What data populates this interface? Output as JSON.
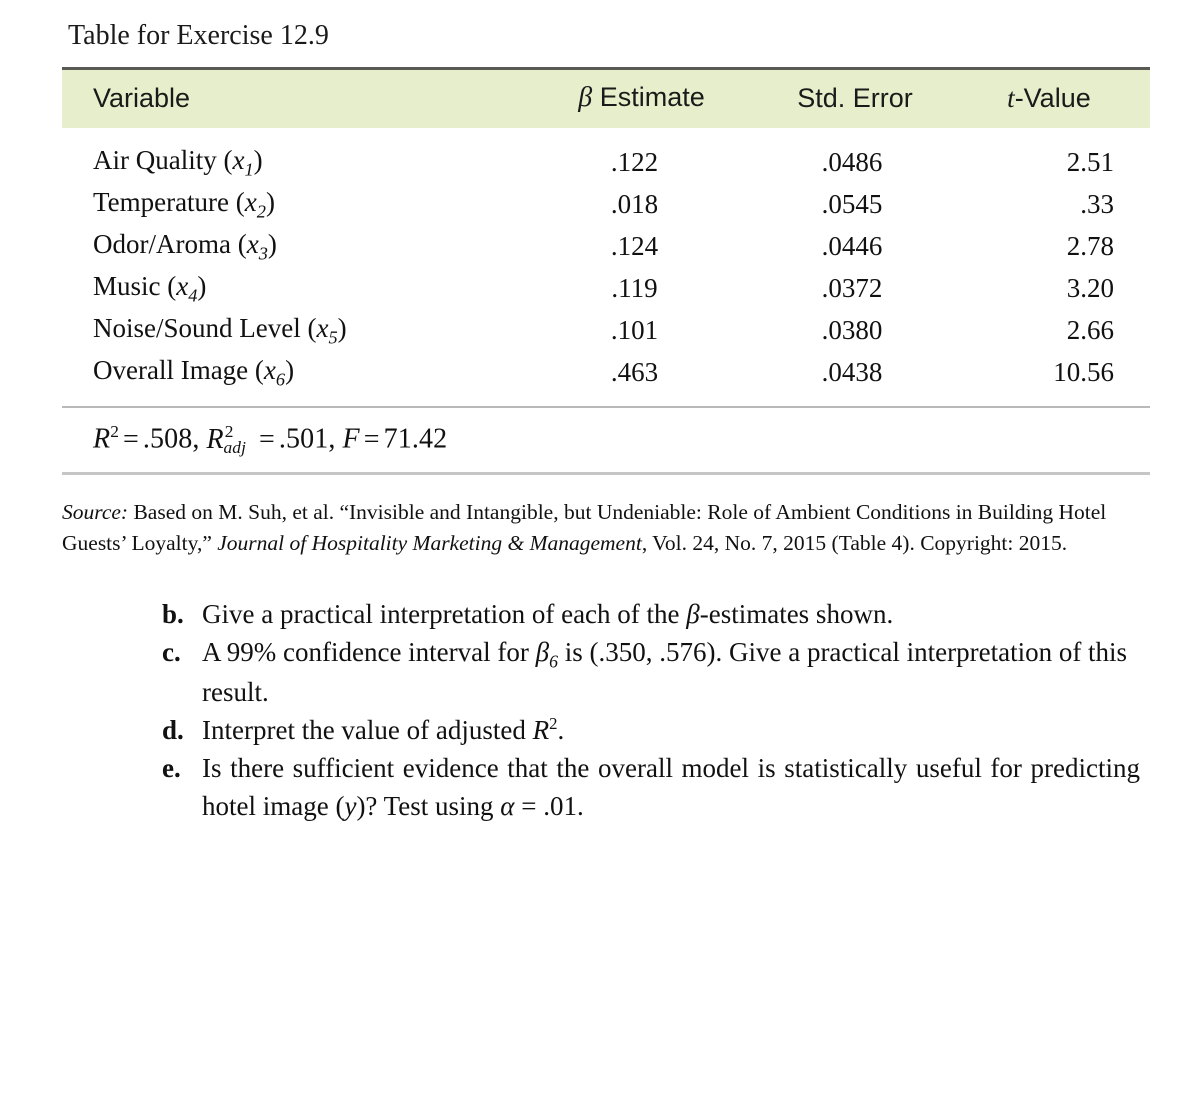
{
  "title": "Table for Exercise 12.9",
  "table": {
    "headers": {
      "variable": "Variable",
      "beta_symbol": "β",
      "beta_estimate": " Estimate",
      "std_error": "Std. Error",
      "t_symbol": "t",
      "t_value": "-Value"
    },
    "rows": [
      {
        "name": "Air Quality",
        "sub": "1",
        "beta": ".122",
        "se": ".0486",
        "t": "2.51"
      },
      {
        "name": "Temperature",
        "sub": "2",
        "beta": ".018",
        "se": ".0545",
        "t": ".33"
      },
      {
        "name": "Odor/Aroma",
        "sub": "3",
        "beta": ".124",
        "se": ".0446",
        "t": "2.78"
      },
      {
        "name": "Music",
        "sub": "4",
        "beta": ".119",
        "se": ".0372",
        "t": "3.20"
      },
      {
        "name": "Noise/Sound Level",
        "sub": "5",
        "beta": ".101",
        "se": ".0380",
        "t": "2.66"
      },
      {
        "name": "Overall Image",
        "sub": "6",
        "beta": ".463",
        "se": ".0438",
        "t": "10.56"
      }
    ],
    "stats": {
      "r2_symbol": "R",
      "r2_sup": "2",
      "r2_value": ".508",
      "r2adj_symbol": "R",
      "r2adj_sup": "2",
      "r2adj_sub": "adj",
      "r2adj_value": ".501",
      "f_symbol": "F",
      "f_value": "71.42",
      "equals": "=",
      "comma": ","
    },
    "colors": {
      "header_background": "#e7eecb",
      "top_rule": "#5a5a55",
      "mid_rule": "#b9b9b9",
      "bottom_rule": "#c6c6c6"
    }
  },
  "source_note": {
    "label": "Source:",
    "part1": " Based on M. Suh, et al. “Invisible and Intangible, but Undeniable: Role of Ambient Conditions in Building Hotel Guests’ Loyalty,” ",
    "journal": "Journal of Hospitality Marketing & Management",
    "part2": ", Vol. 24, No. 7, 2015 (Table 4). Copyright: 2015."
  },
  "exercises": [
    {
      "marker": "b.",
      "pre": "Give a practical interpretation of each of the ",
      "sym": "β",
      "post": "-estimates shown."
    },
    {
      "marker": "c.",
      "pre": "A 99% confidence interval for ",
      "sym": "β",
      "sub": "6",
      "post": " is (.350, .576). Give a practical interpretation of this result."
    },
    {
      "marker": "d.",
      "pre": "Interpret the value of adjusted ",
      "sym": "R",
      "sup": "2",
      "post": "."
    },
    {
      "marker": "e.",
      "pre": "Is there sufficient evidence that the overall model is statistically useful for predicting hotel image (",
      "sym": "y",
      "mid": ")? Test using ",
      "sym2": "α",
      "post": " = .01."
    }
  ]
}
